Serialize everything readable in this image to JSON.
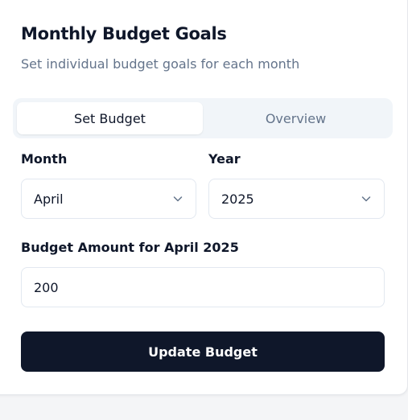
{
  "card": {
    "title": "Monthly Budget Goals",
    "subtitle": "Set individual budget goals for each month"
  },
  "tabs": [
    {
      "label": "Set Budget",
      "active": true
    },
    {
      "label": "Overview",
      "active": false
    }
  ],
  "form": {
    "month_label": "Month",
    "month_value": "April",
    "year_label": "Year",
    "year_value": "2025",
    "amount_label": "Budget Amount for April 2025",
    "amount_value": "200",
    "submit_label": "Update Budget"
  },
  "icons": {
    "month_dropdown": "chevron-down-icon",
    "year_dropdown": "chevron-down-icon"
  },
  "colors": {
    "primary_button": "#0f172a",
    "muted_text": "#64748b",
    "tab_track": "#f1f5f9",
    "border": "#e2e8f0"
  }
}
